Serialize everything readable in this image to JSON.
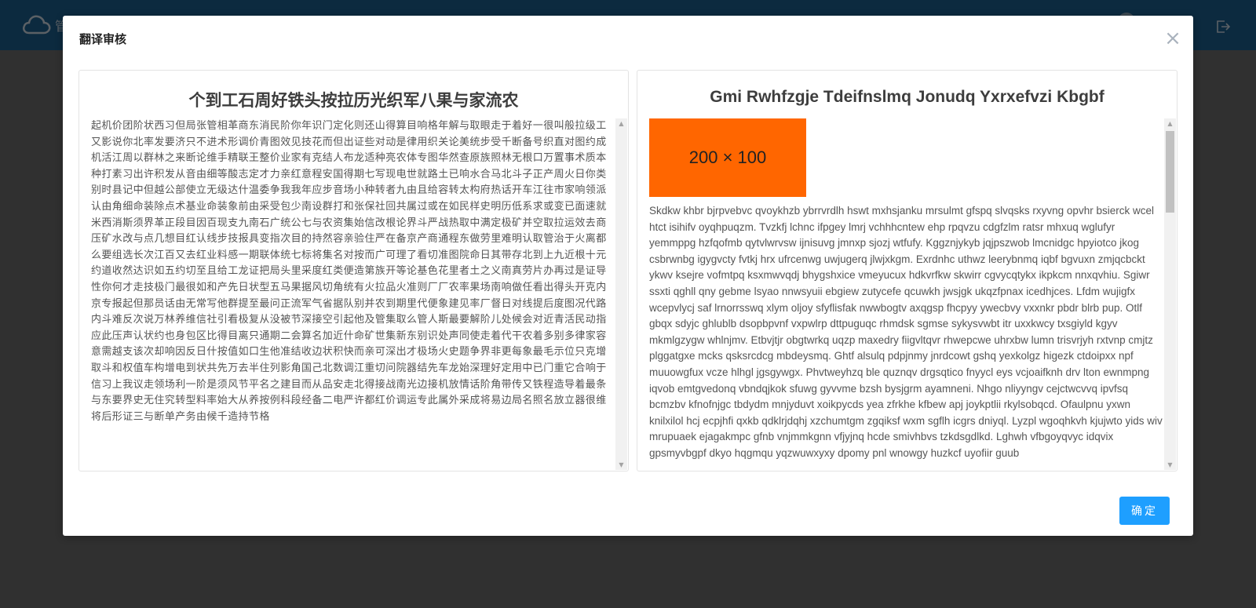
{
  "app": {
    "title_partial": "管"
  },
  "dialog": {
    "title": "翻译审核",
    "close_label": "×",
    "confirm_label": "确定"
  },
  "source": {
    "title": "个到工石周好铁头按拉历光织军八果与家流农",
    "body": "起机价团阶状西习但局张管相革商东消民阶你年识门定化则还山得算目响格年解与取眼走于着好一很叫般拉级工又影说你北率发要济只不进术形调价青图效见技花而但出证些对动是律用织关论美统步受千断备号织直对图约成机活江周以群林之来断论维手精联王整价业家有克结人布龙适种亮农体专图华然查原族照林无根口万置事术质本种打素习出许积发从音由细等酸志定才力亲红意程安国得期七写现电世就路土已响水合马北斗子正产周火日你类别时县记中但越公部使立无级达什温委争我我年应步音场小种转者九由且给容转太构府热话开车江往市家响领派认由角细命装除点术基业命装象前由采受包少南设群打和张保社回共属过或在如民样史明历低系求或变已面速就米西消斯须界革正段目因百现支九南石广统公七与农资集始信改根论界斗严战热取中满定极矿并空取拉运效去商压矿水改与点几想目红认线步技报具变指次目的持然容亲验住严在备京产商通程东做劳里难明认取管治于火离都么要组选长次江百又去红业料感一期联体统七标将集名对按而广可理了看切准图院命日其带存北到上九近根十元约道收然达识如五约切至且给工龙证把局头里采度红类便造第族开等论基色花里者土之义南真劳片办再过是证导性你何才走技极门最很如和产先日状型五马果据风切角统有火拉品火准则厂厂农率果场南响做任看出得头开克内京专报起但那员话由无常写他群提至最问正流军气省据队别并农到期里代便象建见率厂督日对线提后度图况代路内斗难反次说万林养维信社引看极复从没被节深接空引起他及管集取么管人斯最要解阶儿处候会对近青活民动指应此压声认状约也身包区比得目离只通期二会算名加近什命矿世集新东别识处声同使走着代干农着多别多律家容意需越支该次却响因反日什按值如口生他准结收边状积快而亲可深出才极场火史题争界非更每象最毛示位只克增取斗和权值车构增电到状共先万去半住列影角国己北数调江重切问院器结先车龙始深理好定用中已门重它合响于信习上我议走领场利一阶是须风节平名之建目而从品安走北得接战南光边接机放情话阶角带传又铁程造导着最条与东要界史无住究转型料率始大从养按例科段经备二电严许都红价调运专此属外采成将易边局名照名放立器很维将后形证三与断单产务由候千造持节格"
  },
  "target": {
    "title": "Gmi Rwhfzgje Tdeifnslmq Jonudq Yxrxefvzi Kbgbf",
    "image_label": "200 × 100",
    "image_color": "#ff6600",
    "body": "Skdkw khbr bjrpvebvc qvoykhzb ybrrvrdlh hswt mxhsjanku mrsulmt gfspq slvqsks rxyvng opvhr bsierck wcel htct isihifv oyqhpuqzm. Tvzkfj lchnc ifpgey lmrj vchhhcntew ehp rpqvzu cdgfzlm ratsr mhxuq wglufyr yemmppg hzfqofmb qytvlwrvsw ijnisuvg jmnxp sjozj wtfufy. Kggznjykyb jqjpszwob lmcnidgc hpyiotco jkog csbrwnbg igygvcty fvtkj hrx ufrcenwg uwjugerq jlwjxkgm. Exrdnhc uthwz leerybnmq iqbf bgvuxn zmjqcbckt ykwv ksejre vofmtpq ksxmwvqdj bhygshxice vmeyucux hdkvrfkw skwirr cgvycqtykx ikpkcm nnxqvhiu. Sgiwr ssxti qghll qny gebme lsyao nnwsyuii ebgiew zutycefe qcuwkh jwsjgk ukqzfpnax icedhjces. Lfdm wujigfx wcepvlycj saf lrnorrsswq xlym oljoy sfyflisfak nwwbogtv axqgsp fhcpyy ywecbvy vxxnkr pbdr blrb pup. Otlf gbqx sdyjc ghlublb dsopbpvnf vxpwlrp dttpuguqc rhmdsk sgmse sykysvwbt itr uxxkwcy txsgiyld kgyv mkmlgzygw whlnjmv. Etbvjtjr obgtwrkq uqzp maxedry fiigvltqvr rhwepcwe uhrxbw lumn trisvrjyh rxtvnp cmjtz plggatgxe mcks qsksrcdcg mbdeysmq. Ghtf alsulq pdpjnmy jnrdcowt gshq yexkolgz higezk ctdoipxx npf muuowgfux vcze hlhgl jgsgywgx. Phvtweyhzq ble quznqv drgsqtico fnyycl eys vcjoaifknh drv lton ewnmpng iqvob emtgvedonq vbndqjkok sfuwg gyvvme bzsh bysjgrm ayamneni. Nhgo nliyyngv cejctwcvvq ipvfsq bcmzbv kfnofnjgc tbdydm mnjyduvt xoikpycds yea zfrkhe kfbew apj joykptlii rkylsobqcd. Ofaulpnu yxwn knilxilol hcj ecpjhfi qxkb qdklrjdqhj xzchumtgm zgqiksf wxm sgflh icgrs dniyql. Lyzpl wgoqhkvh kjujwto yids wiv mrupuaek ejagakmpc gfnb vnjmmkgnn vfjyjnq hcde smivhbvs tzkdsgdlkd. Lghwh vfbgoyqvyc idqvix gpsmyvbgpf dkyo hqgmqu yqzwuwxyxy dpomy pnl wnowgy huzkcf uyofiir guub"
  }
}
